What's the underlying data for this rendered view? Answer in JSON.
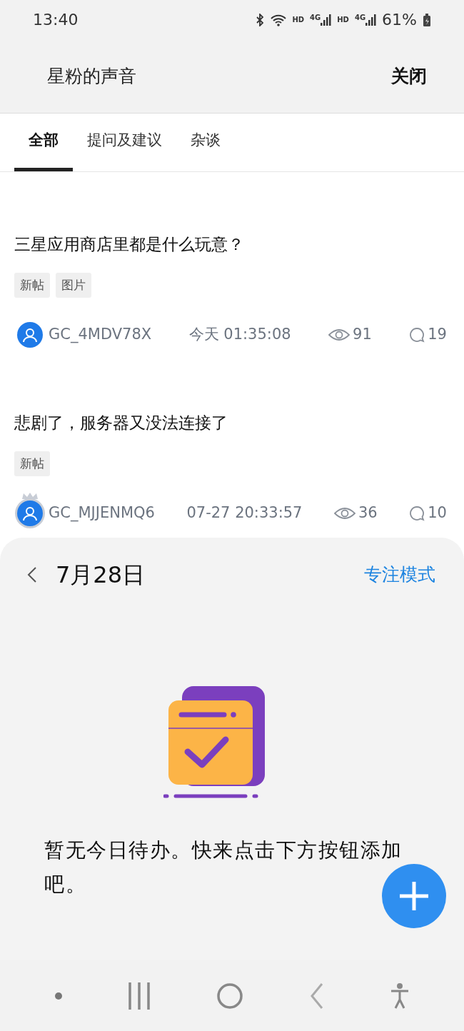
{
  "status_bar": {
    "time": "13:40",
    "sims": [
      {
        "hd": "HD",
        "net": "4G"
      },
      {
        "hd": "HD",
        "net": "4G"
      }
    ],
    "battery": "61%"
  },
  "header": {
    "title": "星粉的声音",
    "close": "关闭"
  },
  "tabs": [
    {
      "label": "全部",
      "selected": true
    },
    {
      "label": "提问及建议",
      "selected": false
    },
    {
      "label": "杂谈",
      "selected": false
    }
  ],
  "posts": [
    {
      "title": "三星应用商店里都是什么玩意？",
      "tags": [
        "新帖",
        "图片"
      ],
      "author": "GC_4MDV78X",
      "crowned": false,
      "time": "今天 01:35:08",
      "views": "91",
      "comments": "19"
    },
    {
      "title": "悲剧了，服务器又没法连接了",
      "tags": [
        "新帖"
      ],
      "author": "GC_MJJENMQ6",
      "crowned": true,
      "time": "07-27 20:33:57",
      "views": "36",
      "comments": "10"
    }
  ],
  "todo_panel": {
    "date": "7月28日",
    "focus_mode": "专注模式",
    "empty_message": "暂无今日待办。快来点击下方按钮添加吧。"
  }
}
